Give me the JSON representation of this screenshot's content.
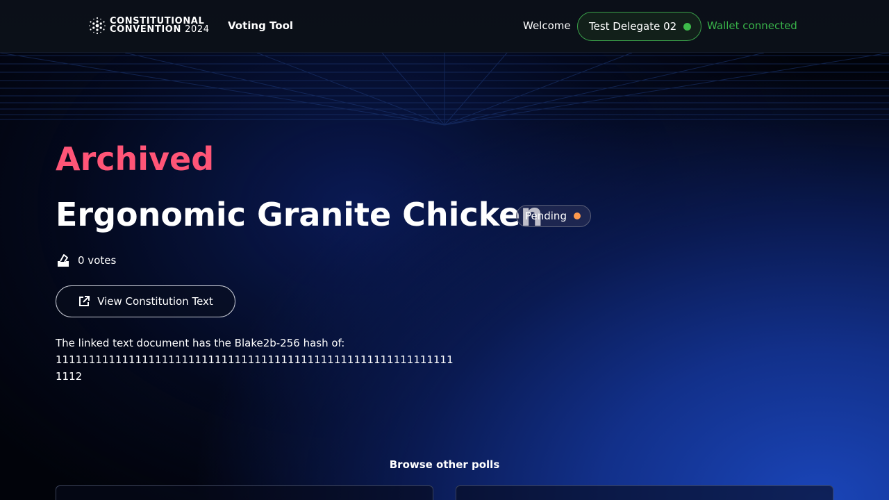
{
  "header": {
    "logo_line1": "CONSTITUTIONAL",
    "logo_line2": "CONVENTION",
    "logo_year": "2024",
    "nav_title": "Voting Tool",
    "welcome": "Welcome",
    "user_name": "Test Delegate 02",
    "wallet_status": "Wallet connected"
  },
  "poll": {
    "status": "Archived",
    "title": "Ergonomic Granite Chicken",
    "badge": "Pending",
    "votes": "0 votes",
    "view_button": "View Constitution Text",
    "hash_label": "The linked text document has the Blake2b-256 hash of:",
    "hash_value": "1111111111111111111111111111111111111111111111111111111111111112"
  },
  "browse": {
    "heading": "Browse other polls"
  },
  "colors": {
    "archived": "#ff5577",
    "wallet_green": "#39b54a",
    "pending_dot": "#ff9a4d"
  },
  "icons": {
    "logo": "cardano-logo-icon",
    "ballot": "ballot-box-icon",
    "external": "external-link-icon"
  }
}
